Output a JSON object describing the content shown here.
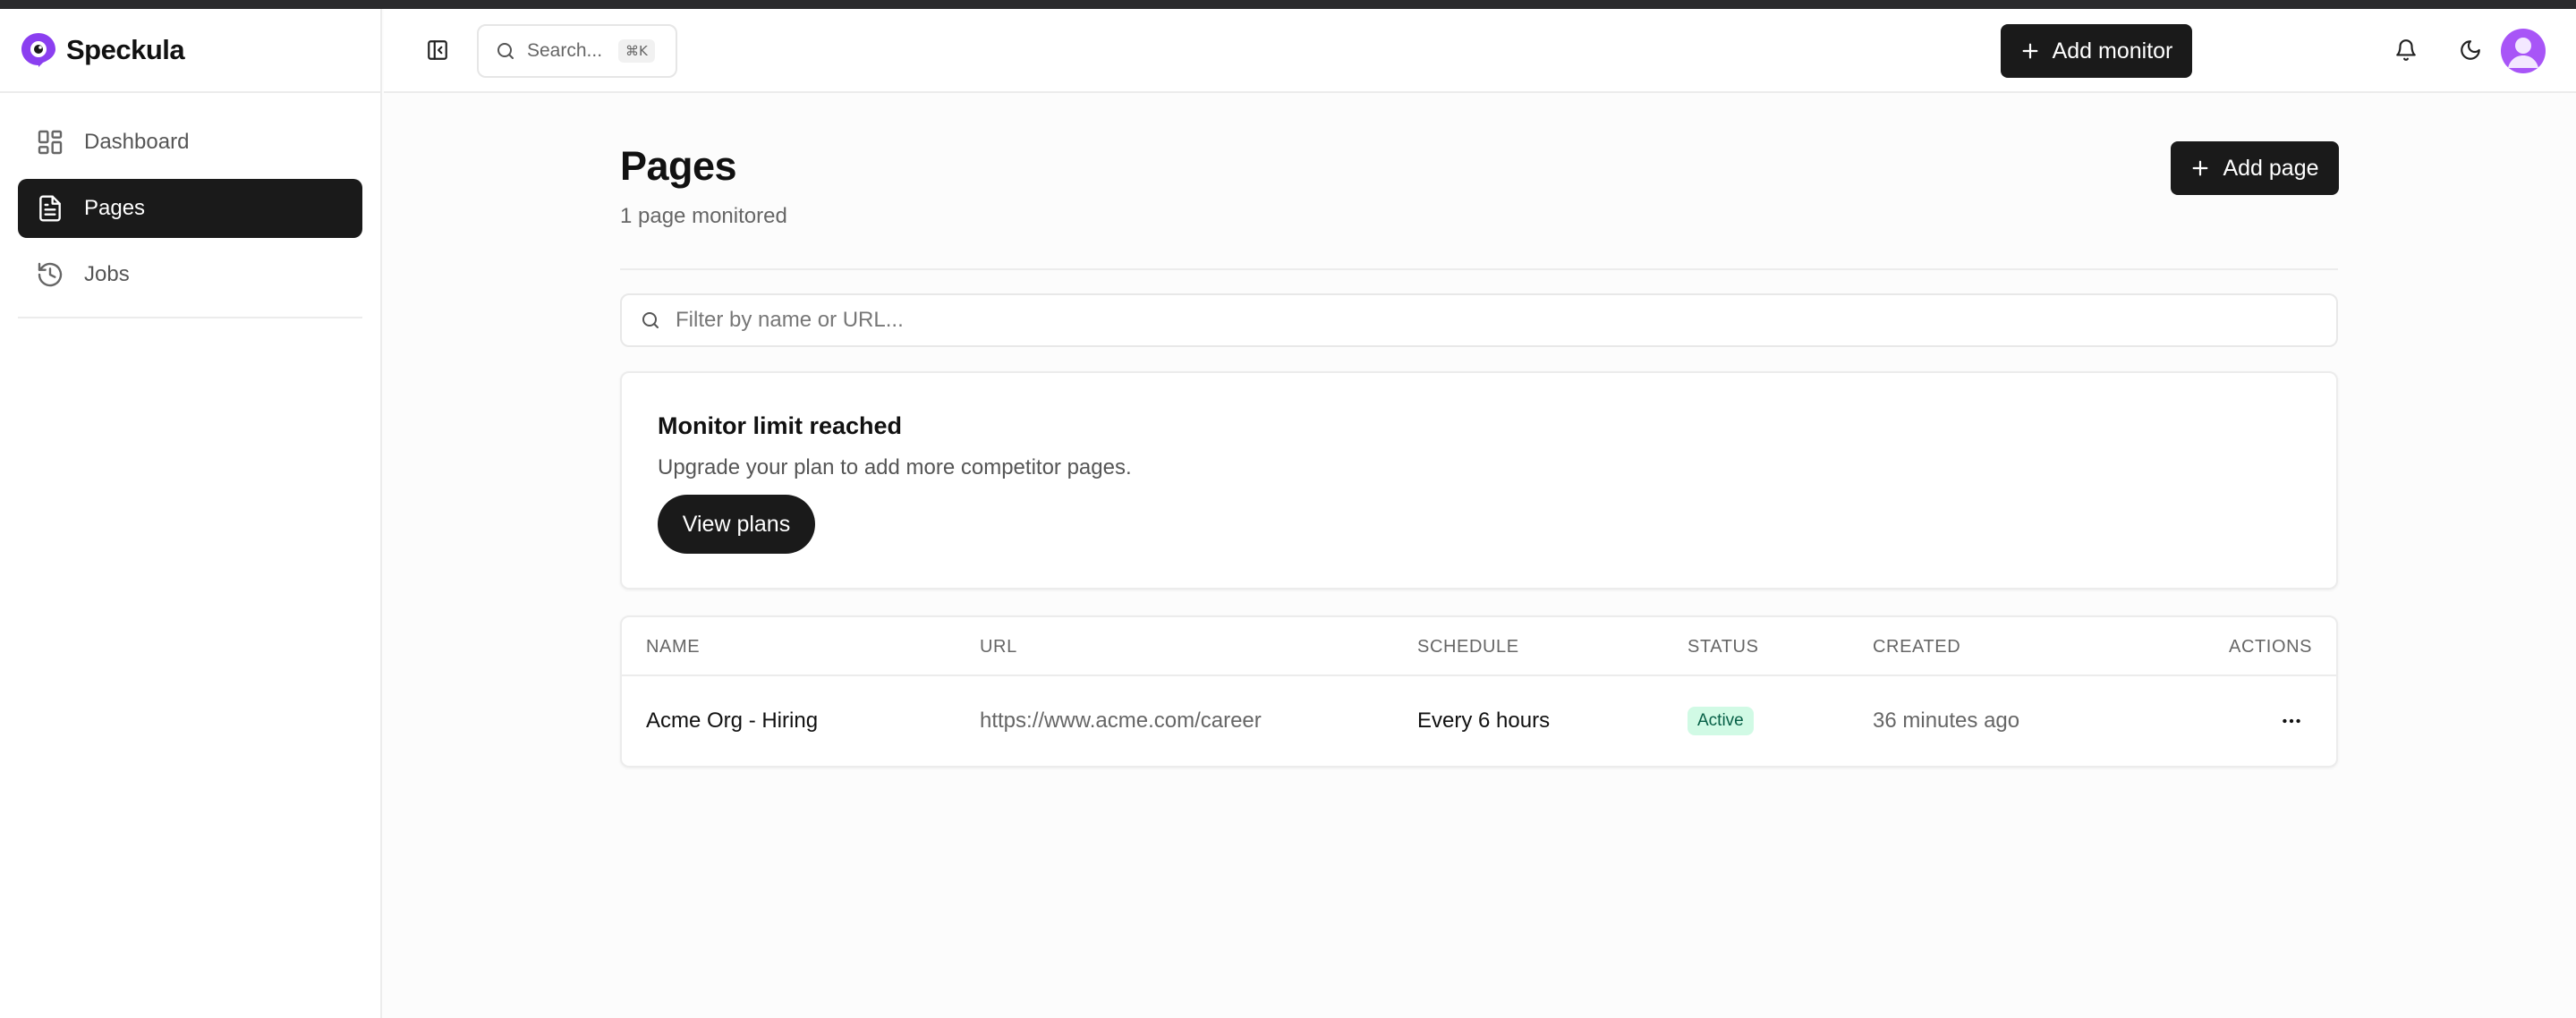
{
  "app": {
    "name": "Speckula"
  },
  "sidebar": {
    "items": [
      {
        "label": "Dashboard",
        "icon": "dashboard-icon",
        "active": false
      },
      {
        "label": "Pages",
        "icon": "document-icon",
        "active": true
      },
      {
        "label": "Jobs",
        "icon": "history-icon",
        "active": false
      }
    ]
  },
  "header": {
    "search_placeholder": "Search...",
    "search_shortcut": "⌘K",
    "add_monitor_label": "Add monitor"
  },
  "page": {
    "title": "Pages",
    "subtitle": "1 page monitored",
    "add_page_label": "Add page",
    "filter_placeholder": "Filter by name or URL..."
  },
  "limit_notice": {
    "title": "Monitor limit reached",
    "text": "Upgrade your plan to add more competitor pages.",
    "button_label": "View plans"
  },
  "table": {
    "columns": [
      "NAME",
      "URL",
      "SCHEDULE",
      "STATUS",
      "CREATED",
      "ACTIONS"
    ],
    "rows": [
      {
        "name": "Acme Org - Hiring",
        "url": "https://www.acme.com/career",
        "schedule": "Every 6 hours",
        "status": "Active",
        "created": "36 minutes ago"
      }
    ]
  },
  "colors": {
    "primary": "#1a1a1a",
    "brand": "#8b3ff0",
    "avatar": "#a855f7",
    "status_active_bg": "#d1fae5",
    "status_active_text": "#065f46"
  }
}
